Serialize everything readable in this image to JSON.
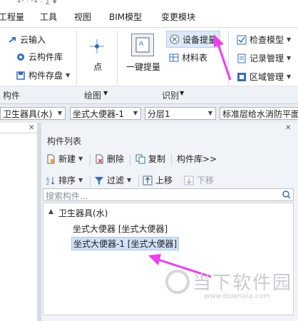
{
  "menu": [
    "工程量",
    "工具",
    "视图",
    "BIM模型",
    "变更模块"
  ],
  "ribbon": {
    "component_group": {
      "items": [
        "云输入",
        "云构件库",
        "构件存盘"
      ],
      "group_label": "构件"
    },
    "draw_group": {
      "point_label": "点",
      "group_label": "绘图"
    },
    "identify_group": {
      "one_click_label": "一键提量",
      "equipment_label": "设备提量",
      "material_label": "材料表",
      "group_label": "识别"
    },
    "check_group": {
      "items": [
        "检查模型",
        "记录管理",
        "区域管理"
      ]
    }
  },
  "combos": {
    "category": "卫生器具(水)",
    "component": "坐式大便器-1",
    "layer": "分层1",
    "floor": "标准层给水消防平面"
  },
  "panel": {
    "title": "构件列表",
    "toolbar1": {
      "new": "新建",
      "delete": "删除",
      "copy": "复制",
      "library": "构件库>>"
    },
    "toolbar2": {
      "sort": "排序",
      "filter": "过滤",
      "move_up": "上移",
      "move_down": "下移"
    },
    "search_placeholder": "搜索构件...",
    "tree": {
      "root": "卫生器具(水)",
      "children": [
        "坐式大便器 [坐式大便器]",
        "坐式大便器-1 [坐式大便器]"
      ]
    }
  },
  "watermark": {
    "text": "当下软件园",
    "url": "www.downxia.com"
  },
  "colors": {
    "accent_arrow": "#f13cf0",
    "selection": "#cfe1f6",
    "panel_bg": "#f0f3f7"
  }
}
